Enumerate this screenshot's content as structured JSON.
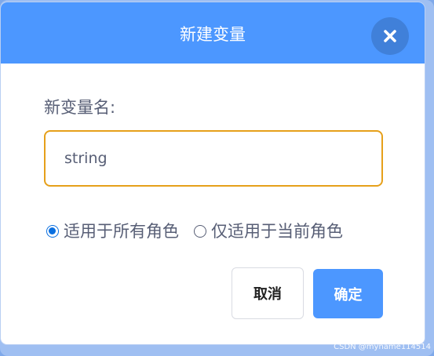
{
  "dialog": {
    "title": "新建变量",
    "close_icon": "close-icon"
  },
  "form": {
    "name_label": "新变量名:",
    "name_value": "string"
  },
  "scope": {
    "options": [
      {
        "label": "适用于所有角色",
        "checked": true
      },
      {
        "label": "仅适用于当前角色",
        "checked": false
      }
    ]
  },
  "actions": {
    "cancel_label": "取消",
    "ok_label": "确定"
  },
  "watermark": "CSDN @myname114514",
  "colors": {
    "header": "#4c97ff",
    "input_focus_border": "#e6a01a",
    "primary_button": "#4c97ff",
    "text": "#575e75",
    "radio_selected": "#0a6fe0"
  }
}
